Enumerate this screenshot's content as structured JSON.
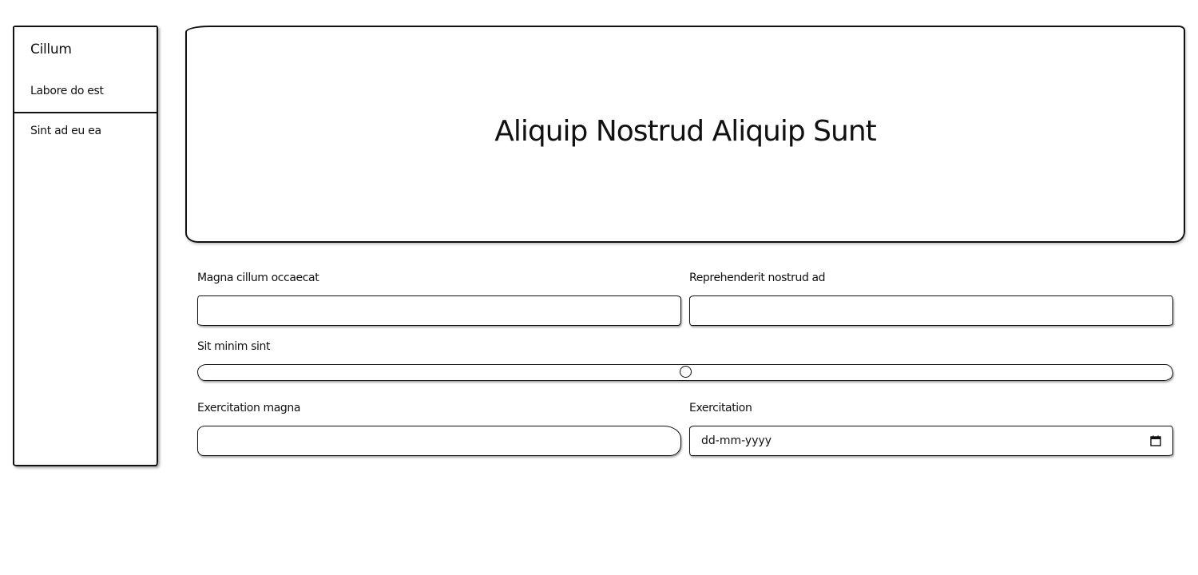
{
  "sidebar": {
    "title": "Cillum",
    "items": [
      {
        "label": "Labore do est"
      },
      {
        "label": "Sint ad eu ea"
      }
    ]
  },
  "hero": {
    "title": "Aliquip Nostrud Aliquip Sunt"
  },
  "form": {
    "field1": {
      "label": "Magna cillum occaecat",
      "value": ""
    },
    "field2": {
      "label": "Reprehenderit nostrud ad",
      "value": ""
    },
    "slider": {
      "label": "Sit minim sint",
      "value_fraction": 0.5
    },
    "field3": {
      "label": "Exercitation magna",
      "value": ""
    },
    "field4": {
      "label": "Exercitation",
      "placeholder": "dd-mm-yyyy"
    }
  },
  "icons": {
    "calendar": "calendar-icon"
  }
}
